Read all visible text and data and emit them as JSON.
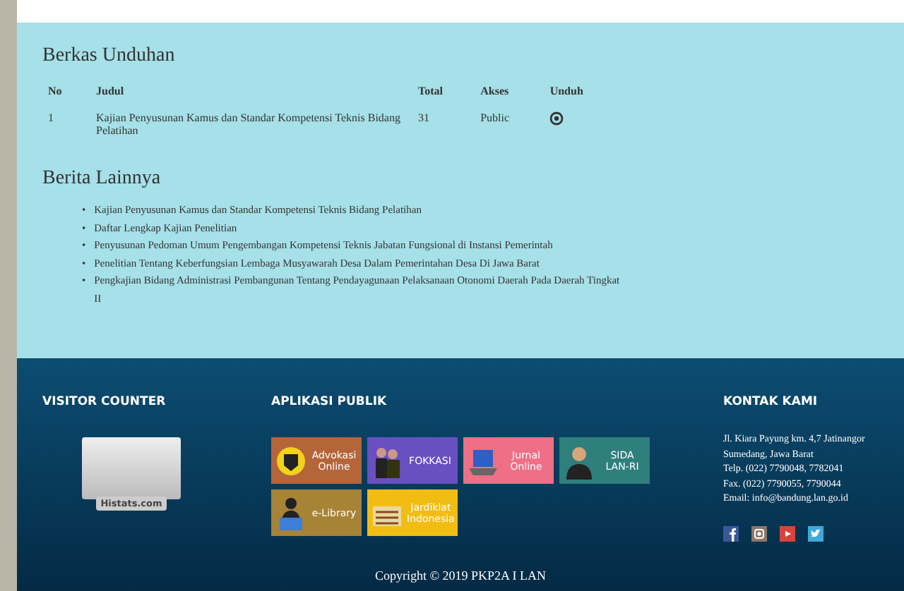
{
  "downloads": {
    "title": "Berkas Unduhan",
    "columns": [
      "No",
      "Judul",
      "Total",
      "Akses",
      "Unduh"
    ],
    "rows": [
      {
        "no": "1",
        "title": "Kajian Penyusunan Kamus dan Standar Kompetensi Teknis Bidang Pelatihan",
        "total": "31",
        "access": "Public"
      }
    ]
  },
  "news": {
    "title": "Berita Lainnya",
    "items": [
      {
        "marker": "•",
        "text": "Kajian Penyusunan Kamus dan Standar Kompetensi Teknis Bidang Pelatihan"
      },
      {
        "marker": "•",
        "text": "Daftar Lengkap Kajian Penelitian"
      },
      {
        "marker": "•",
        "text": "Penyusunan Pedoman Umum Pengembangan Kompetensi Teknis Jabatan Fungsional di Instansi Pemerintah"
      },
      {
        "marker": "•",
        "text": "Penelitian Tentang Keberfungsian Lembaga Musyawarah Desa Dalam Pemerintahan Desa Di Jawa Barat"
      },
      {
        "marker": "•",
        "text": "Pengkajian Bidang Administrasi Pembangunan Tentang Pendayagunaan Pelaksanaan Otonomi Daerah Pada Daerah Tingkat II"
      }
    ]
  },
  "footer": {
    "visitor_counter": {
      "title": "VISITOR COUNTER",
      "label": "Histats.com"
    },
    "apps": {
      "title": "APLIKASI PUBLIK",
      "tiles": [
        {
          "label": "Advokasi Online",
          "kind": "badge",
          "color": "#b5653a"
        },
        {
          "label": "FOKKASI",
          "kind": "people",
          "color": "#6a4fc0"
        },
        {
          "label": "Jurnal Online",
          "kind": "laptop",
          "color": "#ee6f86"
        },
        {
          "label": "SIDA LAN-RI",
          "kind": "person",
          "color": "#2f7f7c"
        },
        {
          "label": "e-Library",
          "kind": "reader",
          "color": "#a78336"
        },
        {
          "label": "Jardiklat Indonesia",
          "kind": "books",
          "color": "#f2bd12"
        }
      ]
    },
    "contact": {
      "title": "KONTAK KAMI",
      "lines": [
        "Jl. Kiara Payung km. 4,7 Jatinangor",
        "Sumedang, Jawa Barat",
        "Telp. (022) 7790048, 7782041",
        "Fax. (022) 7790055, 7790044",
        "Email: info@bandung.lan.go.id"
      ],
      "social": [
        {
          "kind": "facebook",
          "color": "#3b5998"
        },
        {
          "kind": "instagram",
          "color": "#8a7766"
        },
        {
          "kind": "youtube",
          "color": "#d9443a"
        },
        {
          "kind": "twitter",
          "color": "#3fa9d9"
        }
      ]
    },
    "copyright": "Copyright © 2019 PKP2A I LAN"
  }
}
